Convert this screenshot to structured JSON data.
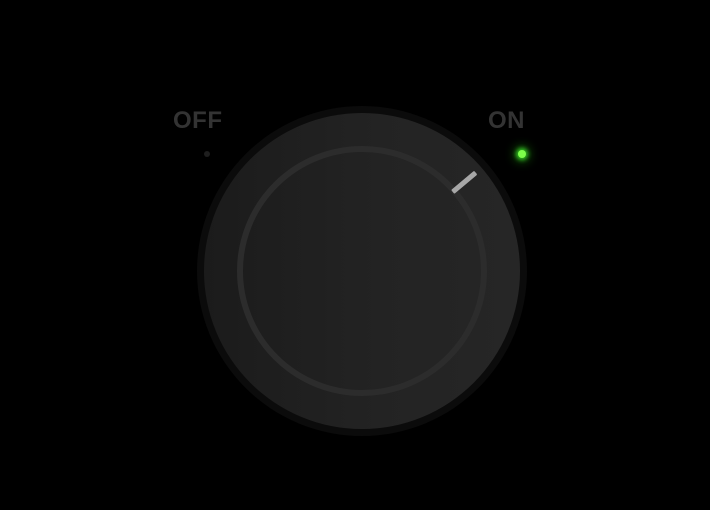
{
  "switch": {
    "off_label": "OFF",
    "on_label": "ON",
    "state": "on",
    "indicator_icon": "knob-pointer-icon",
    "led_on_color": "#7dff4a",
    "led_off_color": "#1e1e1e"
  }
}
